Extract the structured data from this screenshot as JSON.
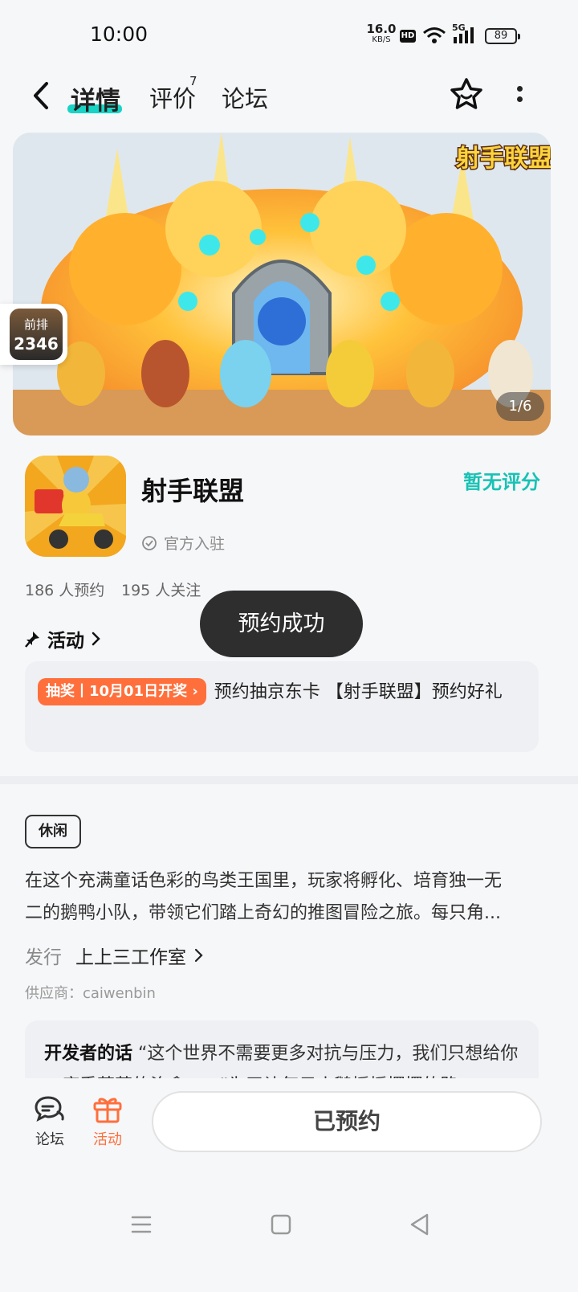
{
  "status_bar": {
    "time": "10:00",
    "net_speed_value": "16.0",
    "net_speed_unit": "KB/S",
    "hd": "HD",
    "network": "5G",
    "battery": "89"
  },
  "nav": {
    "tabs": [
      {
        "label": "详情",
        "active": true
      },
      {
        "label": "评价",
        "badge": "7"
      },
      {
        "label": "论坛"
      }
    ]
  },
  "banner": {
    "counter": "1/6",
    "logo_text": "射手联盟"
  },
  "rank_badge": {
    "label": "前排",
    "value": "2346"
  },
  "app": {
    "name": "射手联盟",
    "official": "官方入驻",
    "rating": "暂无评分",
    "reserve_count": "186 人预约",
    "follow_count": "195 人关注"
  },
  "activity": {
    "heading": "活动",
    "tag": "抽奖丨10月01日开奖",
    "text": "预约抽京东卡 【射手联盟】预约好礼"
  },
  "toast": "预约成功",
  "details": {
    "genre": "休闲",
    "description": "在这个充满童话色彩的鸟类王国里，玩家将孵化、培育独一无\n二的鹅鸭小队，带领它们踏上奇幻的推图冒险之旅。每只角...",
    "publisher_label": "发行",
    "publisher_name": "上上三工作室",
    "supplier": "供应商：caiwenbin",
    "dev_title": "开发者的话",
    "dev_text": "“这个世界不需要更多对抗与压力，我们只想给你一席乖萌萌的治愈......”为了让每只小鹅摇摇摆摆的路"
  },
  "bottom": {
    "forum_label": "论坛",
    "activity_label": "活动",
    "reserved_label": "已预约"
  },
  "colors": {
    "accent": "#19d3c5",
    "orange": "#ff6f3c",
    "toast_bg": "#2e2e2e"
  }
}
